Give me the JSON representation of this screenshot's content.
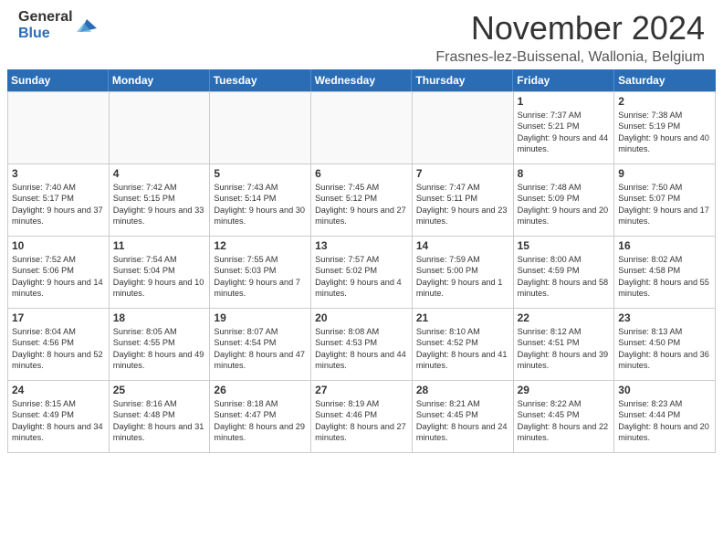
{
  "header": {
    "logo_general": "General",
    "logo_blue": "Blue",
    "month_title": "November 2024",
    "location": "Frasnes-lez-Buissenal, Wallonia, Belgium"
  },
  "weekdays": [
    "Sunday",
    "Monday",
    "Tuesday",
    "Wednesday",
    "Thursday",
    "Friday",
    "Saturday"
  ],
  "rows": [
    [
      {
        "day": "",
        "info": "",
        "empty": true
      },
      {
        "day": "",
        "info": "",
        "empty": true
      },
      {
        "day": "",
        "info": "",
        "empty": true
      },
      {
        "day": "",
        "info": "",
        "empty": true
      },
      {
        "day": "",
        "info": "",
        "empty": true
      },
      {
        "day": "1",
        "info": "Sunrise: 7:37 AM\nSunset: 5:21 PM\nDaylight: 9 hours and 44 minutes."
      },
      {
        "day": "2",
        "info": "Sunrise: 7:38 AM\nSunset: 5:19 PM\nDaylight: 9 hours and 40 minutes."
      }
    ],
    [
      {
        "day": "3",
        "info": "Sunrise: 7:40 AM\nSunset: 5:17 PM\nDaylight: 9 hours and 37 minutes."
      },
      {
        "day": "4",
        "info": "Sunrise: 7:42 AM\nSunset: 5:15 PM\nDaylight: 9 hours and 33 minutes."
      },
      {
        "day": "5",
        "info": "Sunrise: 7:43 AM\nSunset: 5:14 PM\nDaylight: 9 hours and 30 minutes."
      },
      {
        "day": "6",
        "info": "Sunrise: 7:45 AM\nSunset: 5:12 PM\nDaylight: 9 hours and 27 minutes."
      },
      {
        "day": "7",
        "info": "Sunrise: 7:47 AM\nSunset: 5:11 PM\nDaylight: 9 hours and 23 minutes."
      },
      {
        "day": "8",
        "info": "Sunrise: 7:48 AM\nSunset: 5:09 PM\nDaylight: 9 hours and 20 minutes."
      },
      {
        "day": "9",
        "info": "Sunrise: 7:50 AM\nSunset: 5:07 PM\nDaylight: 9 hours and 17 minutes."
      }
    ],
    [
      {
        "day": "10",
        "info": "Sunrise: 7:52 AM\nSunset: 5:06 PM\nDaylight: 9 hours and 14 minutes."
      },
      {
        "day": "11",
        "info": "Sunrise: 7:54 AM\nSunset: 5:04 PM\nDaylight: 9 hours and 10 minutes."
      },
      {
        "day": "12",
        "info": "Sunrise: 7:55 AM\nSunset: 5:03 PM\nDaylight: 9 hours and 7 minutes."
      },
      {
        "day": "13",
        "info": "Sunrise: 7:57 AM\nSunset: 5:02 PM\nDaylight: 9 hours and 4 minutes."
      },
      {
        "day": "14",
        "info": "Sunrise: 7:59 AM\nSunset: 5:00 PM\nDaylight: 9 hours and 1 minute."
      },
      {
        "day": "15",
        "info": "Sunrise: 8:00 AM\nSunset: 4:59 PM\nDaylight: 8 hours and 58 minutes."
      },
      {
        "day": "16",
        "info": "Sunrise: 8:02 AM\nSunset: 4:58 PM\nDaylight: 8 hours and 55 minutes."
      }
    ],
    [
      {
        "day": "17",
        "info": "Sunrise: 8:04 AM\nSunset: 4:56 PM\nDaylight: 8 hours and 52 minutes."
      },
      {
        "day": "18",
        "info": "Sunrise: 8:05 AM\nSunset: 4:55 PM\nDaylight: 8 hours and 49 minutes."
      },
      {
        "day": "19",
        "info": "Sunrise: 8:07 AM\nSunset: 4:54 PM\nDaylight: 8 hours and 47 minutes."
      },
      {
        "day": "20",
        "info": "Sunrise: 8:08 AM\nSunset: 4:53 PM\nDaylight: 8 hours and 44 minutes."
      },
      {
        "day": "21",
        "info": "Sunrise: 8:10 AM\nSunset: 4:52 PM\nDaylight: 8 hours and 41 minutes."
      },
      {
        "day": "22",
        "info": "Sunrise: 8:12 AM\nSunset: 4:51 PM\nDaylight: 8 hours and 39 minutes."
      },
      {
        "day": "23",
        "info": "Sunrise: 8:13 AM\nSunset: 4:50 PM\nDaylight: 8 hours and 36 minutes."
      }
    ],
    [
      {
        "day": "24",
        "info": "Sunrise: 8:15 AM\nSunset: 4:49 PM\nDaylight: 8 hours and 34 minutes."
      },
      {
        "day": "25",
        "info": "Sunrise: 8:16 AM\nSunset: 4:48 PM\nDaylight: 8 hours and 31 minutes."
      },
      {
        "day": "26",
        "info": "Sunrise: 8:18 AM\nSunset: 4:47 PM\nDaylight: 8 hours and 29 minutes."
      },
      {
        "day": "27",
        "info": "Sunrise: 8:19 AM\nSunset: 4:46 PM\nDaylight: 8 hours and 27 minutes."
      },
      {
        "day": "28",
        "info": "Sunrise: 8:21 AM\nSunset: 4:45 PM\nDaylight: 8 hours and 24 minutes."
      },
      {
        "day": "29",
        "info": "Sunrise: 8:22 AM\nSunset: 4:45 PM\nDaylight: 8 hours and 22 minutes."
      },
      {
        "day": "30",
        "info": "Sunrise: 8:23 AM\nSunset: 4:44 PM\nDaylight: 8 hours and 20 minutes."
      }
    ]
  ]
}
